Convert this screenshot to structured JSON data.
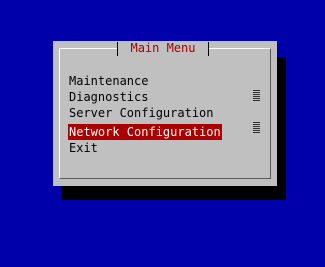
{
  "dialog": {
    "title": "Main Menu",
    "items": [
      {
        "label": "Maintenance"
      },
      {
        "label": "Diagnostics"
      },
      {
        "label": "Server Configuration"
      },
      {
        "label": "Network Configuration"
      },
      {
        "label": "Exit"
      }
    ],
    "selected_index": 3
  },
  "colors": {
    "background": "#0000aa",
    "dialog": "#c0c0c0",
    "title_text": "#aa0000",
    "highlight": "#aa0000",
    "highlight_text": "#ffffff"
  }
}
